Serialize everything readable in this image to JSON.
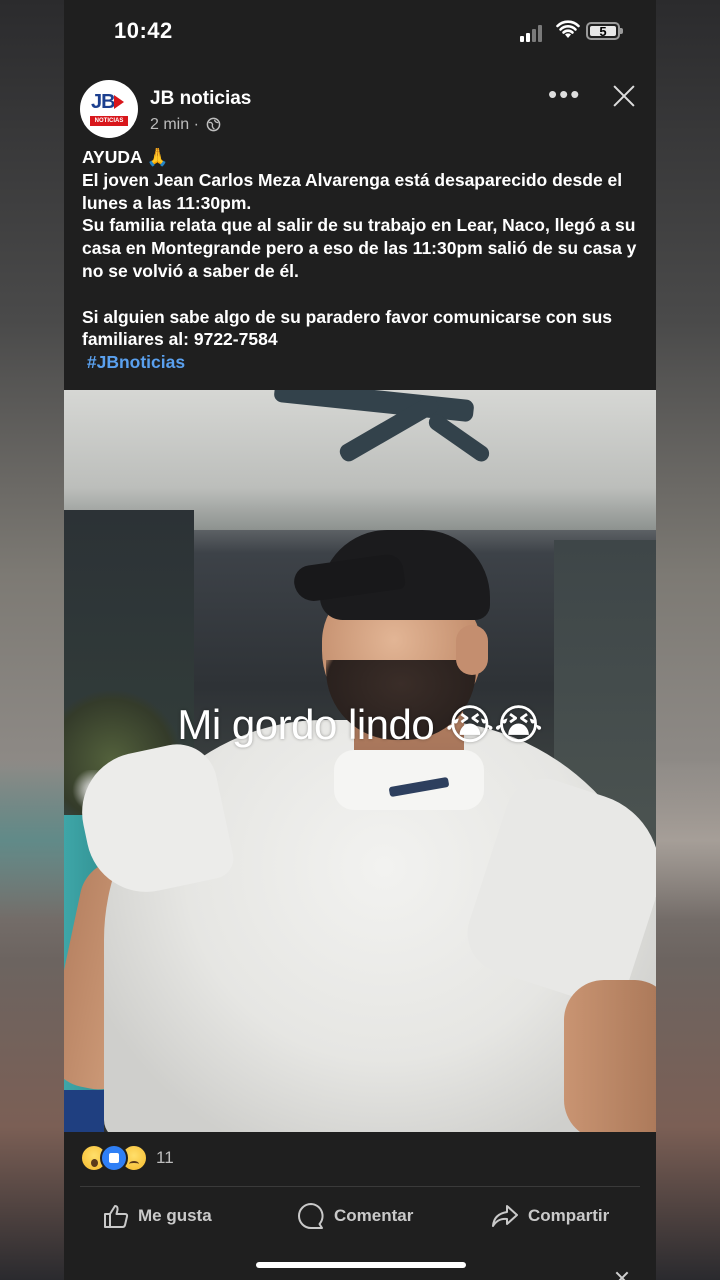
{
  "status_bar": {
    "time": "10:42",
    "battery": "5"
  },
  "post": {
    "page_name": "JB noticias",
    "avatar_text": "JB",
    "avatar_subtext": "NOTICIAS",
    "meta_time": "2 min ·",
    "more_label": "•••",
    "text_lines": [
      "AYUDA 🙏",
      "El joven Jean Carlos Meza Alvarenga está desaparecido desde el lunes a las 11:30pm.",
      " Su familia relata que al salir de su trabajo en Lear, Naco, llegó a su casa en Montegrande pero a eso de las 11:30pm salió de su casa y no se volvió a saber de él.",
      "",
      " Si alguien sabe algo de su paradero favor comunicarse con sus familiares al: 9722-7584"
    ],
    "hashtag": "#JBnoticias",
    "photo_caption": "Mi gordo lindo 😭😭",
    "reaction_count": "11",
    "actions": {
      "like": "Me gusta",
      "comment": "Comentar",
      "share": "Compartir"
    }
  },
  "colors": {
    "background": "#1f1f1f",
    "hashtag": "#5aa0ee",
    "like_blue": "#2f7ff5",
    "brand_red": "#d8161b",
    "brand_blue": "#1c3f8f"
  }
}
